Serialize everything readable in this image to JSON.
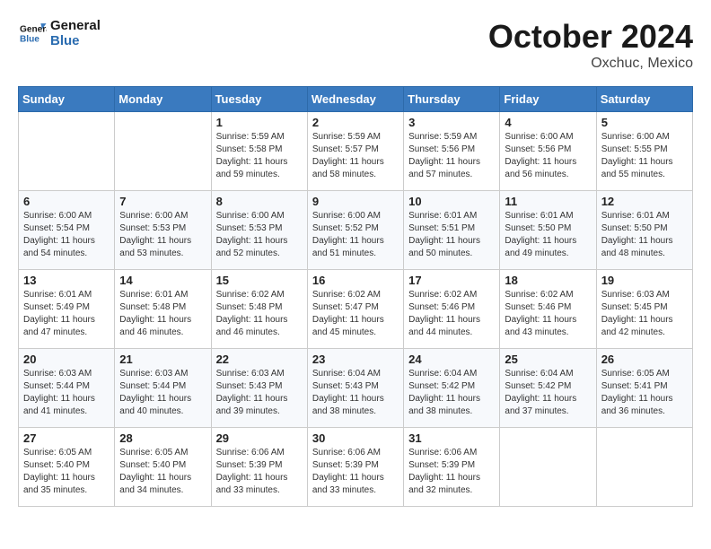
{
  "header": {
    "logo_line1": "General",
    "logo_line2": "Blue",
    "month": "October 2024",
    "location": "Oxchuc, Mexico"
  },
  "weekdays": [
    "Sunday",
    "Monday",
    "Tuesday",
    "Wednesday",
    "Thursday",
    "Friday",
    "Saturday"
  ],
  "weeks": [
    [
      {
        "day": "",
        "info": ""
      },
      {
        "day": "",
        "info": ""
      },
      {
        "day": "1",
        "info": "Sunrise: 5:59 AM\nSunset: 5:58 PM\nDaylight: 11 hours and 59 minutes."
      },
      {
        "day": "2",
        "info": "Sunrise: 5:59 AM\nSunset: 5:57 PM\nDaylight: 11 hours and 58 minutes."
      },
      {
        "day": "3",
        "info": "Sunrise: 5:59 AM\nSunset: 5:56 PM\nDaylight: 11 hours and 57 minutes."
      },
      {
        "day": "4",
        "info": "Sunrise: 6:00 AM\nSunset: 5:56 PM\nDaylight: 11 hours and 56 minutes."
      },
      {
        "day": "5",
        "info": "Sunrise: 6:00 AM\nSunset: 5:55 PM\nDaylight: 11 hours and 55 minutes."
      }
    ],
    [
      {
        "day": "6",
        "info": "Sunrise: 6:00 AM\nSunset: 5:54 PM\nDaylight: 11 hours and 54 minutes."
      },
      {
        "day": "7",
        "info": "Sunrise: 6:00 AM\nSunset: 5:53 PM\nDaylight: 11 hours and 53 minutes."
      },
      {
        "day": "8",
        "info": "Sunrise: 6:00 AM\nSunset: 5:53 PM\nDaylight: 11 hours and 52 minutes."
      },
      {
        "day": "9",
        "info": "Sunrise: 6:00 AM\nSunset: 5:52 PM\nDaylight: 11 hours and 51 minutes."
      },
      {
        "day": "10",
        "info": "Sunrise: 6:01 AM\nSunset: 5:51 PM\nDaylight: 11 hours and 50 minutes."
      },
      {
        "day": "11",
        "info": "Sunrise: 6:01 AM\nSunset: 5:50 PM\nDaylight: 11 hours and 49 minutes."
      },
      {
        "day": "12",
        "info": "Sunrise: 6:01 AM\nSunset: 5:50 PM\nDaylight: 11 hours and 48 minutes."
      }
    ],
    [
      {
        "day": "13",
        "info": "Sunrise: 6:01 AM\nSunset: 5:49 PM\nDaylight: 11 hours and 47 minutes."
      },
      {
        "day": "14",
        "info": "Sunrise: 6:01 AM\nSunset: 5:48 PM\nDaylight: 11 hours and 46 minutes."
      },
      {
        "day": "15",
        "info": "Sunrise: 6:02 AM\nSunset: 5:48 PM\nDaylight: 11 hours and 46 minutes."
      },
      {
        "day": "16",
        "info": "Sunrise: 6:02 AM\nSunset: 5:47 PM\nDaylight: 11 hours and 45 minutes."
      },
      {
        "day": "17",
        "info": "Sunrise: 6:02 AM\nSunset: 5:46 PM\nDaylight: 11 hours and 44 minutes."
      },
      {
        "day": "18",
        "info": "Sunrise: 6:02 AM\nSunset: 5:46 PM\nDaylight: 11 hours and 43 minutes."
      },
      {
        "day": "19",
        "info": "Sunrise: 6:03 AM\nSunset: 5:45 PM\nDaylight: 11 hours and 42 minutes."
      }
    ],
    [
      {
        "day": "20",
        "info": "Sunrise: 6:03 AM\nSunset: 5:44 PM\nDaylight: 11 hours and 41 minutes."
      },
      {
        "day": "21",
        "info": "Sunrise: 6:03 AM\nSunset: 5:44 PM\nDaylight: 11 hours and 40 minutes."
      },
      {
        "day": "22",
        "info": "Sunrise: 6:03 AM\nSunset: 5:43 PM\nDaylight: 11 hours and 39 minutes."
      },
      {
        "day": "23",
        "info": "Sunrise: 6:04 AM\nSunset: 5:43 PM\nDaylight: 11 hours and 38 minutes."
      },
      {
        "day": "24",
        "info": "Sunrise: 6:04 AM\nSunset: 5:42 PM\nDaylight: 11 hours and 38 minutes."
      },
      {
        "day": "25",
        "info": "Sunrise: 6:04 AM\nSunset: 5:42 PM\nDaylight: 11 hours and 37 minutes."
      },
      {
        "day": "26",
        "info": "Sunrise: 6:05 AM\nSunset: 5:41 PM\nDaylight: 11 hours and 36 minutes."
      }
    ],
    [
      {
        "day": "27",
        "info": "Sunrise: 6:05 AM\nSunset: 5:40 PM\nDaylight: 11 hours and 35 minutes."
      },
      {
        "day": "28",
        "info": "Sunrise: 6:05 AM\nSunset: 5:40 PM\nDaylight: 11 hours and 34 minutes."
      },
      {
        "day": "29",
        "info": "Sunrise: 6:06 AM\nSunset: 5:39 PM\nDaylight: 11 hours and 33 minutes."
      },
      {
        "day": "30",
        "info": "Sunrise: 6:06 AM\nSunset: 5:39 PM\nDaylight: 11 hours and 33 minutes."
      },
      {
        "day": "31",
        "info": "Sunrise: 6:06 AM\nSunset: 5:39 PM\nDaylight: 11 hours and 32 minutes."
      },
      {
        "day": "",
        "info": ""
      },
      {
        "day": "",
        "info": ""
      }
    ]
  ]
}
